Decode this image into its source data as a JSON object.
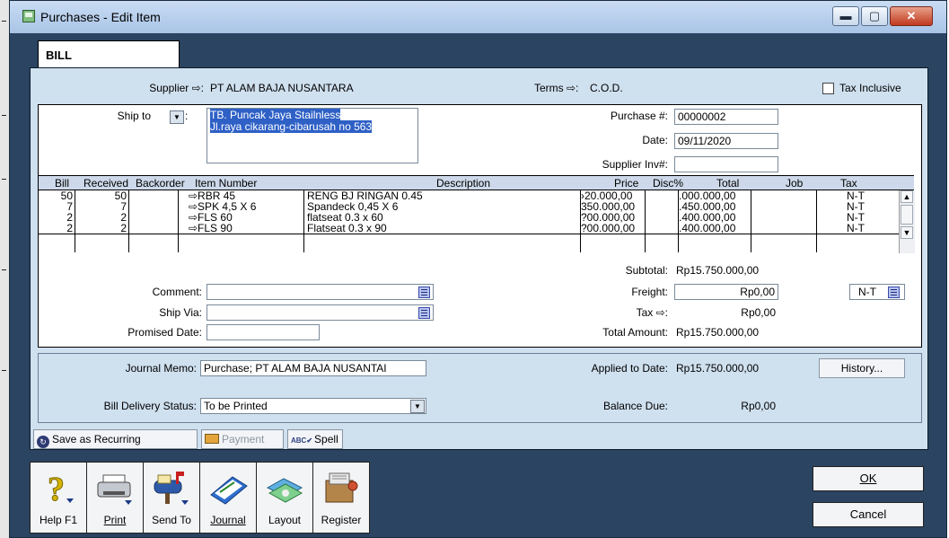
{
  "window": {
    "title": "Purchases - Edit Item",
    "min_glyph": "▬",
    "max_glyph": "▢",
    "close_glyph": "✕"
  },
  "tab": {
    "label": "BILL"
  },
  "header": {
    "supplier_label": "Supplier ⇨:",
    "supplier_value": "PT ALAM BAJA NUSANTARA",
    "terms_label": "Terms ⇨:",
    "terms_value": "C.O.D.",
    "tax_inclusive_label": "Tax Inclusive",
    "tax_inclusive_checked": false
  },
  "ship_to": {
    "label": "Ship to",
    "line1": "TB. Puncak Jaya Stailnless",
    "line2": "Jl.raya cikarang-cibarusah no 563"
  },
  "purchase": {
    "purchase_no_label": "Purchase #:",
    "purchase_no": "00000002",
    "date_label": "Date:",
    "date": "09/11/2020",
    "supplier_inv_label": "Supplier Inv#:",
    "supplier_inv": ""
  },
  "table": {
    "columns": [
      "Bill",
      "Received",
      "Backorder",
      "Item Number",
      "Description",
      "Price",
      "Disc%",
      "Total",
      "Job",
      "Tax"
    ],
    "rows": [
      {
        "bill": "50",
        "received": "50",
        "backorder": "",
        "item": "⇨RBR 45",
        "description": "RENG BJ RINGAN 0.45",
        "price": "›20.000,00",
        "disc": "",
        "total": ".000.000,00",
        "job": "",
        "tax": "N-T"
      },
      {
        "bill": "7",
        "received": "7",
        "backorder": "",
        "item": "⇨SPK 4,5 X 6",
        "description": "Spandeck 0,45 X 6",
        "price": "350.000,00",
        "disc": "",
        "total": ".450.000,00",
        "job": "",
        "tax": "N-T"
      },
      {
        "bill": "2",
        "received": "2",
        "backorder": "",
        "item": "⇨FLS 60",
        "description": "flatseat 0.3 x 60",
        "price": "?00.000,00",
        "disc": "",
        "total": ".400.000,00",
        "job": "",
        "tax": "N-T"
      },
      {
        "bill": "2",
        "received": "2",
        "backorder": "",
        "item": "⇨FLS 90",
        "description": "Flatseat 0.3 x 90",
        "price": "?00.000,00",
        "disc": "",
        "total": ".400.000,00",
        "job": "",
        "tax": "N-T"
      }
    ]
  },
  "totals": {
    "subtotal_label": "Subtotal:",
    "subtotal": "Rp15.750.000,00",
    "freight_label": "Freight:",
    "freight": "Rp0,00",
    "freight_tax": "N-T",
    "tax_label": "Tax ⇨:",
    "tax": "Rp0,00",
    "total_label": "Total Amount:",
    "total": "Rp15.750.000,00"
  },
  "details": {
    "comment_label": "Comment:",
    "comment": "",
    "ship_via_label": "Ship Via:",
    "ship_via": "",
    "promised_date_label": "Promised Date:",
    "promised_date": ""
  },
  "journal": {
    "memo_label": "Journal Memo:",
    "memo": "Purchase; PT ALAM BAJA NUSANTAI",
    "applied_label": "Applied to Date:",
    "applied": "Rp15.750.000,00",
    "history_button": "History...",
    "delivery_label": "Bill Delivery Status:",
    "delivery": "To be Printed",
    "balance_label": "Balance Due:",
    "balance": "Rp0,00"
  },
  "actions": {
    "recurring": "Save as Recurring",
    "payment": "Payment",
    "spell": "Spell"
  },
  "toolbar": {
    "help": "Help F1",
    "print": "Print",
    "send_to": "Send To",
    "journal": "Journal",
    "layout": "Layout",
    "register": "Register"
  },
  "dialog": {
    "ok": "OK",
    "cancel": "Cancel"
  },
  "icons": {
    "app": "purchases-window-icon",
    "help": "question-mark-icon",
    "print": "printer-icon",
    "send_to": "mailbox-icon",
    "journal": "journal-book-icon",
    "layout": "layout-cards-icon",
    "register": "register-drawer-icon"
  },
  "colors": {
    "frame": "#2a4461",
    "form_bg": "#cfe0ef",
    "selection": "#2e60c6",
    "table_header": "#cdd9ea"
  }
}
